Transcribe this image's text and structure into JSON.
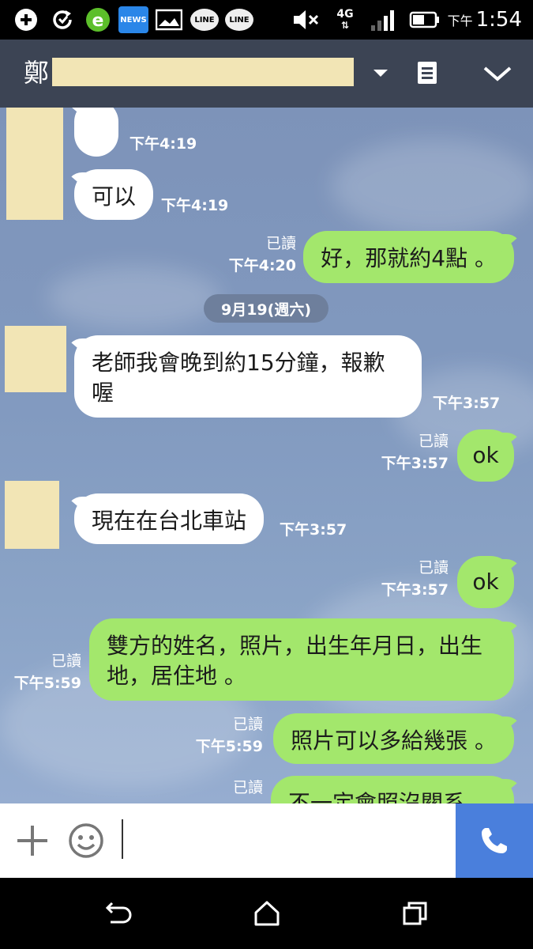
{
  "status_bar": {
    "news_label": "NEWS",
    "line_label_1": "LINE",
    "line_label_2": "LINE",
    "network": "4G",
    "ampm": "下午",
    "time": "1:54"
  },
  "header": {
    "title_char": "鄭"
  },
  "chat": {
    "date_separator": "9月19(週六)",
    "messages": [
      {
        "side": "in",
        "text": "",
        "time": "下午4:19"
      },
      {
        "side": "in",
        "text": "可以",
        "time": "下午4:19"
      },
      {
        "side": "out",
        "text": "好，那就約4點 。",
        "read": "已讀",
        "time": "下午4:20"
      },
      {
        "side": "in",
        "text": "老師我會晚到約15分鐘，報歉喔",
        "time": "下午3:57"
      },
      {
        "side": "out",
        "text": "ok",
        "read": "已讀",
        "time": "下午3:57"
      },
      {
        "side": "in",
        "text": "現在在台北車站",
        "time": "下午3:57"
      },
      {
        "side": "out",
        "text": "ok",
        "read": "已讀",
        "time": "下午3:57"
      },
      {
        "side": "out",
        "text": "雙方的姓名，照片，出生年月日，出生地，居住地 。",
        "read": "已讀",
        "time": "下午5:59"
      },
      {
        "side": "out",
        "text": "照片可以多給幾張 。",
        "read": "已讀",
        "time": "下午5:59"
      },
      {
        "side": "out",
        "text": "不一定會照沒關系",
        "read": "已讀",
        "time": ""
      }
    ]
  },
  "input": {
    "placeholder": "",
    "value": ""
  },
  "colors": {
    "header_bg": "#3c4454",
    "incoming_bubble": "#ffffff",
    "outgoing_bubble": "#a3e76c",
    "call_button": "#4a7fdc",
    "redaction": "#f2e5b5"
  },
  "icons": {
    "status": [
      "plus-icon",
      "sync-icon",
      "ie-browser-icon",
      "news-icon",
      "image-icon",
      "line-icon",
      "line-icon",
      "mute-icon",
      "network-4g-icon",
      "signal-icon",
      "battery-icon"
    ],
    "header": [
      "dropdown-icon",
      "notes-icon",
      "collapse-icon"
    ],
    "input": [
      "plus-icon",
      "emoji-icon",
      "phone-icon"
    ],
    "nav": [
      "back-icon",
      "home-icon",
      "recent-apps-icon"
    ]
  }
}
